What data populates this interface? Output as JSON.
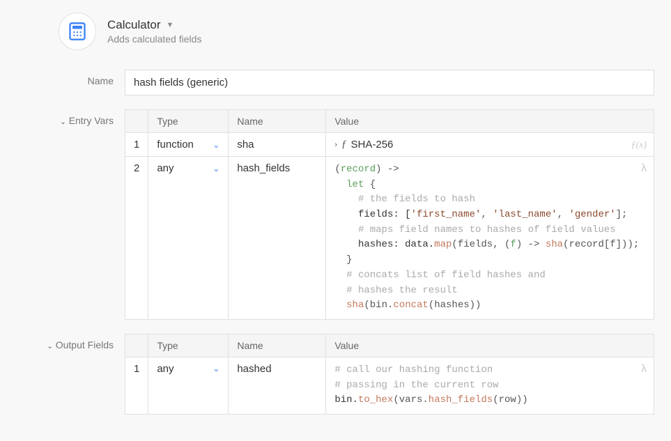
{
  "header": {
    "title": "Calculator",
    "subtitle": "Adds calculated fields"
  },
  "name": {
    "label": "Name",
    "value": "hash fields (generic)"
  },
  "entryVars": {
    "label": "Entry Vars",
    "columns": {
      "type": "Type",
      "name": "Name",
      "value": "Value"
    },
    "rows": [
      {
        "idx": "1",
        "type": "function",
        "name": "sha",
        "valueLabel": "SHA-256"
      },
      {
        "idx": "2",
        "type": "any",
        "name": "hash_fields"
      }
    ],
    "code2": {
      "l1a": "(",
      "l1b": "record",
      "l1c": ") ->",
      "l2a": "  ",
      "l2b": "let",
      "l2c": " {",
      "l3": "    # the fields to hash",
      "l4a": "    fields: [",
      "l4s1": "'first_name'",
      "l4c1": ", ",
      "l4s2": "'last_name'",
      "l4c2": ", ",
      "l4s3": "'gender'",
      "l4e": "];",
      "l5": "    # maps field names to hashes of field values",
      "l6a": "    hashes: data.",
      "l6b": "map",
      "l6c": "(fields, (",
      "l6d": "f",
      "l6e": ") -> ",
      "l6f": "sha",
      "l6g": "(record[f]));",
      "l7": "  }",
      "l8": "  # concats list of field hashes and",
      "l9": "  # hashes the result",
      "l10a": "  ",
      "l10b": "sha",
      "l10c": "(bin.",
      "l10d": "concat",
      "l10e": "(hashes))"
    }
  },
  "outputFields": {
    "label": "Output Fields",
    "columns": {
      "type": "Type",
      "name": "Name",
      "value": "Value"
    },
    "rows": [
      {
        "idx": "1",
        "type": "any",
        "name": "hashed"
      }
    ],
    "code1": {
      "l1": "# call our hashing function",
      "l2": "# passing in the current row",
      "l3a": "bin.",
      "l3b": "to_hex",
      "l3c": "(vars.",
      "l3d": "hash_fields",
      "l3e": "(row))"
    }
  }
}
